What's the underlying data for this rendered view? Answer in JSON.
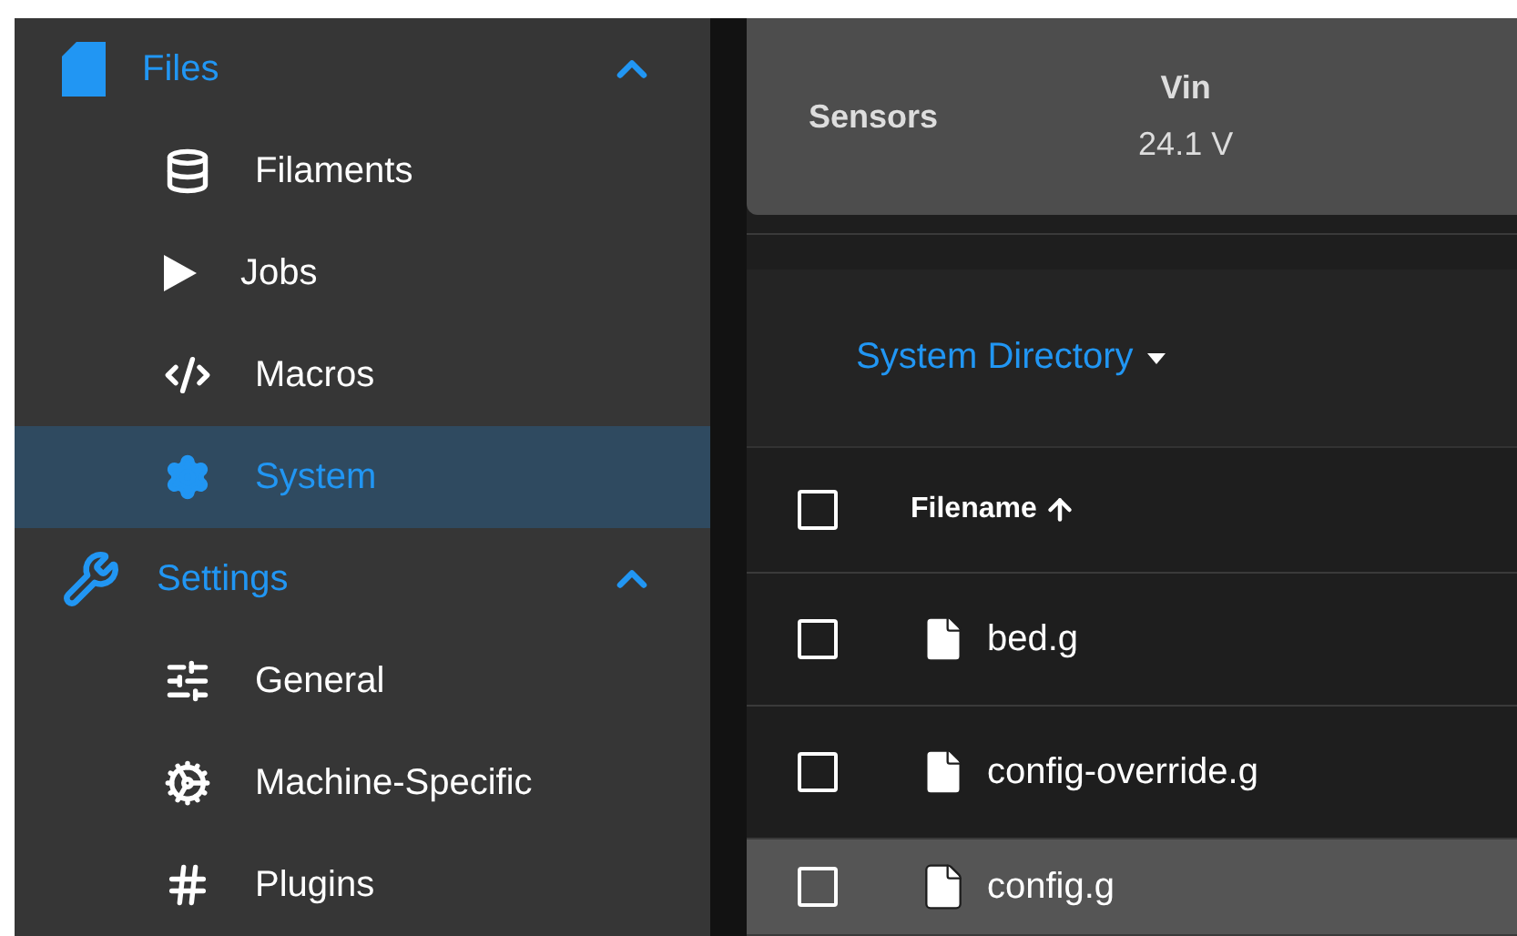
{
  "sidebar": {
    "groups": [
      {
        "label": "Files",
        "expanded": true,
        "items": [
          {
            "label": "Filaments",
            "selected": false
          },
          {
            "label": "Jobs",
            "selected": false
          },
          {
            "label": "Macros",
            "selected": false
          },
          {
            "label": "System",
            "selected": true
          }
        ]
      },
      {
        "label": "Settings",
        "expanded": true,
        "items": [
          {
            "label": "General",
            "selected": false
          },
          {
            "label": "Machine-Specific",
            "selected": false
          },
          {
            "label": "Plugins",
            "selected": false
          }
        ]
      }
    ]
  },
  "sensors": {
    "title": "Sensors",
    "values": [
      {
        "label": "Vin",
        "value": "24.1 V"
      }
    ]
  },
  "directory": {
    "label": "System Directory"
  },
  "table": {
    "all_checked": false,
    "columns": [
      {
        "label": "Filename"
      }
    ],
    "rows": [
      {
        "name": "bed.g",
        "checked": false,
        "selected": false
      },
      {
        "name": "config-override.g",
        "checked": false,
        "selected": false
      },
      {
        "name": "config.g",
        "checked": false,
        "selected": true
      }
    ]
  }
}
